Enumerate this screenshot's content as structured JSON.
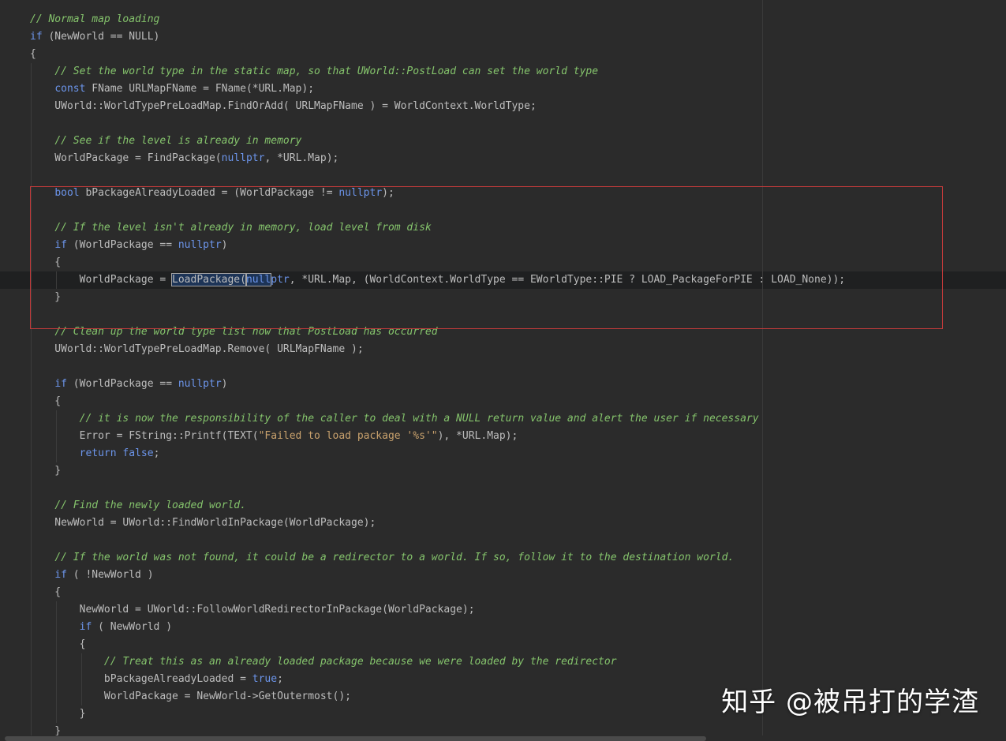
{
  "editor": {
    "lines": [
      [
        {
          "t": "// Normal map loading",
          "c": "cm"
        }
      ],
      [
        {
          "t": "if",
          "c": "kw"
        },
        {
          "t": " (NewWorld == NULL)",
          "c": "plain"
        }
      ],
      [
        {
          "t": "{",
          "c": "plain"
        }
      ],
      [
        {
          "t": "    ",
          "c": "plain"
        },
        {
          "t": "// Set the world type in the static map, so that UWorld::PostLoad can set the world type",
          "c": "cm"
        }
      ],
      [
        {
          "t": "    ",
          "c": "plain"
        },
        {
          "t": "const",
          "c": "kw"
        },
        {
          "t": " FName URLMapFName = FName(*URL.Map);",
          "c": "plain"
        }
      ],
      [
        {
          "t": "    UWorld::WorldTypePreLoadMap.FindOrAdd( URLMapFName ) = WorldContext.WorldType;",
          "c": "plain"
        }
      ],
      [],
      [
        {
          "t": "    ",
          "c": "plain"
        },
        {
          "t": "// See if the level is already in memory",
          "c": "cm"
        }
      ],
      [
        {
          "t": "    WorldPackage = FindPackage(",
          "c": "plain"
        },
        {
          "t": "nullptr",
          "c": "kw"
        },
        {
          "t": ", *URL.Map);",
          "c": "plain"
        }
      ],
      [],
      [
        {
          "t": "    ",
          "c": "plain"
        },
        {
          "t": "bool",
          "c": "kw"
        },
        {
          "t": " bPackageAlreadyLoaded = (WorldPackage != ",
          "c": "plain"
        },
        {
          "t": "nullptr",
          "c": "kw"
        },
        {
          "t": ");",
          "c": "plain"
        }
      ],
      [],
      [
        {
          "t": "    ",
          "c": "plain"
        },
        {
          "t": "// If the level isn't already in memory, load level from disk",
          "c": "cm"
        }
      ],
      [
        {
          "t": "    ",
          "c": "plain"
        },
        {
          "t": "if",
          "c": "kw"
        },
        {
          "t": " (WorldPackage == ",
          "c": "plain"
        },
        {
          "t": "nullptr",
          "c": "kw"
        },
        {
          "t": ")",
          "c": "plain"
        }
      ],
      [
        {
          "t": "    {",
          "c": "plain"
        }
      ],
      [
        {
          "t": "        WorldPackage = ",
          "c": "plain"
        },
        {
          "t": "LoadPackage(",
          "c": "sel"
        },
        {
          "t": "null",
          "c": "kwsel"
        },
        {
          "t": "ptr",
          "c": "kw"
        },
        {
          "t": ", *URL.Map, (WorldContext.WorldType == EWorldType::PIE ? LOAD_PackageForPIE : LOAD_None));",
          "c": "plain"
        }
      ],
      [
        {
          "t": "    }",
          "c": "plain"
        }
      ],
      [],
      [
        {
          "t": "    ",
          "c": "plain"
        },
        {
          "t": "// Clean up the world type list now that PostLoad has occurred",
          "c": "cm"
        }
      ],
      [
        {
          "t": "    UWorld::WorldTypePreLoadMap.Remove( URLMapFName );",
          "c": "plain"
        }
      ],
      [],
      [
        {
          "t": "    ",
          "c": "plain"
        },
        {
          "t": "if",
          "c": "kw"
        },
        {
          "t": " (WorldPackage == ",
          "c": "plain"
        },
        {
          "t": "nullptr",
          "c": "kw"
        },
        {
          "t": ")",
          "c": "plain"
        }
      ],
      [
        {
          "t": "    {",
          "c": "plain"
        }
      ],
      [
        {
          "t": "        ",
          "c": "plain"
        },
        {
          "t": "// it is now the responsibility of the caller to deal with a NULL return value and alert the user if necessary",
          "c": "cm"
        }
      ],
      [
        {
          "t": "        Error = FString::Printf(TEXT(",
          "c": "plain"
        },
        {
          "t": "\"Failed to load package '%s'\"",
          "c": "str"
        },
        {
          "t": "), *URL.Map);",
          "c": "plain"
        }
      ],
      [
        {
          "t": "        ",
          "c": "plain"
        },
        {
          "t": "return",
          "c": "kw"
        },
        {
          "t": " ",
          "c": "plain"
        },
        {
          "t": "false",
          "c": "kw"
        },
        {
          "t": ";",
          "c": "plain"
        }
      ],
      [
        {
          "t": "    }",
          "c": "plain"
        }
      ],
      [],
      [
        {
          "t": "    ",
          "c": "plain"
        },
        {
          "t": "// Find the newly loaded world.",
          "c": "cm"
        }
      ],
      [
        {
          "t": "    NewWorld = UWorld::FindWorldInPackage(WorldPackage);",
          "c": "plain"
        }
      ],
      [],
      [
        {
          "t": "    ",
          "c": "plain"
        },
        {
          "t": "// If the world was not found, it could be a redirector to a world. If so, follow it to the destination world.",
          "c": "cm"
        }
      ],
      [
        {
          "t": "    ",
          "c": "plain"
        },
        {
          "t": "if",
          "c": "kw"
        },
        {
          "t": " ( !NewWorld )",
          "c": "plain"
        }
      ],
      [
        {
          "t": "    {",
          "c": "plain"
        }
      ],
      [
        {
          "t": "        NewWorld = UWorld::FollowWorldRedirectorInPackage(WorldPackage);",
          "c": "plain"
        }
      ],
      [
        {
          "t": "        ",
          "c": "plain"
        },
        {
          "t": "if",
          "c": "kw"
        },
        {
          "t": " ( NewWorld )",
          "c": "plain"
        }
      ],
      [
        {
          "t": "        {",
          "c": "plain"
        }
      ],
      [
        {
          "t": "            ",
          "c": "plain"
        },
        {
          "t": "// Treat this as an already loaded package because we were loaded by the redirector",
          "c": "cm"
        }
      ],
      [
        {
          "t": "            bPackageAlreadyLoaded = ",
          "c": "plain"
        },
        {
          "t": "true",
          "c": "kw"
        },
        {
          "t": ";",
          "c": "plain"
        }
      ],
      [
        {
          "t": "            WorldPackage = NewWorld->GetOutermost();",
          "c": "plain"
        }
      ],
      [
        {
          "t": "        }",
          "c": "plain"
        }
      ],
      [
        {
          "t": "    }",
          "c": "plain"
        }
      ]
    ],
    "current_line_index": 15
  },
  "watermark": {
    "text": "知乎 @被吊打的学渣"
  },
  "colors": {
    "background": "#2b2b2b",
    "keyword": "#6c95eb",
    "comment": "#85c46c",
    "string": "#c9a26d",
    "identifier": "#bdbdbd",
    "highlight_box": "#c23a3a"
  }
}
